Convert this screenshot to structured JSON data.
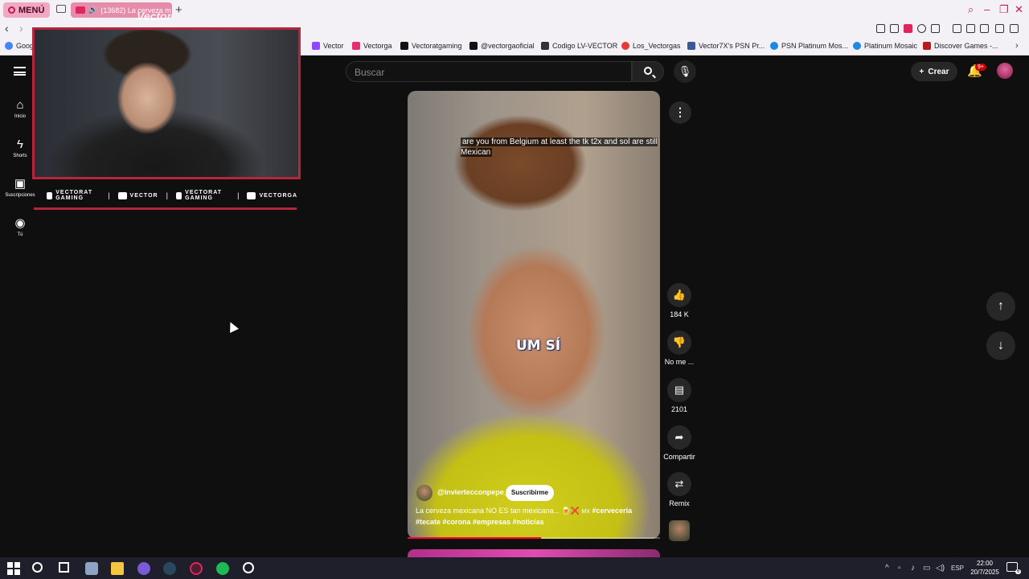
{
  "browser": {
    "menu_label": "MENÚ",
    "active_tab_title": "(13682) La cerveza m",
    "bookmarks": [
      {
        "label": "Goog",
        "color": "#4285f4"
      },
      {
        "label": "Vector",
        "color": "#9146ff"
      },
      {
        "label": "Vectorga",
        "color": "#e1306c"
      },
      {
        "label": "Vectoratgaming",
        "color": "#111111"
      },
      {
        "label": "@vectorgaoficial",
        "color": "#111111"
      },
      {
        "label": "Codigo LV-VECTOR",
        "color": "#333333"
      },
      {
        "label": "Los_Vectorgas",
        "color": "#e53935"
      },
      {
        "label": "Vector7X's PSN Pr...",
        "color": "#3b5998"
      },
      {
        "label": "PSN Platinum Mos...",
        "color": "#1e88e5"
      },
      {
        "label": "Platinum Mosaic",
        "color": "#1e88e5"
      },
      {
        "label": "Discover Games -...",
        "color": "#b71c1c"
      }
    ]
  },
  "youtube": {
    "search_placeholder": "Buscar",
    "create_label": "Crear",
    "notification_count": "9+",
    "sidebar": [
      {
        "icon": "home-icon",
        "glyph": "⌂",
        "label": "Inicio"
      },
      {
        "icon": "shorts-icon",
        "glyph": "ϟ",
        "label": "Shorts"
      },
      {
        "icon": "subscriptions-icon",
        "glyph": "▣",
        "label": "Suscripciones"
      },
      {
        "icon": "you-icon",
        "glyph": "◉",
        "label": "Tú"
      }
    ]
  },
  "short": {
    "caption_top": "are you from Belgium at least the tk t2x and sol are still Mexican",
    "caption_mid": "UM SÍ",
    "channel": "@inviertecconpepe_",
    "subscribe_label": "Suscribirme",
    "description_text": "La cerveza mexicana NO ES tan mexicana... 🍺❌",
    "description_mx": "MX",
    "hashtags_line1": "#cerveceria",
    "hashtags_line2": "#tecate #corona #empresas #noticias",
    "progress": 0.53,
    "actions": {
      "likes": "184 K",
      "dislike_label": "No me ...",
      "comments": "2101",
      "share_label": "Compartir",
      "remix_label": "Remix"
    }
  },
  "overlay": {
    "webcam_logo": "Vector",
    "socials": [
      {
        "icon": "youtube-icon",
        "label": "VECTORAT GAMING"
      },
      {
        "icon": "twitch-icon",
        "label": "VECTOR"
      },
      {
        "icon": "twitter-icon",
        "label": "VECTORAT GAMING"
      },
      {
        "icon": "instagram-icon",
        "label": "VECTORGA"
      }
    ]
  },
  "taskbar": {
    "language": "ESP",
    "time": "22:00",
    "date": "20/7/2025",
    "notification_count": "6"
  }
}
